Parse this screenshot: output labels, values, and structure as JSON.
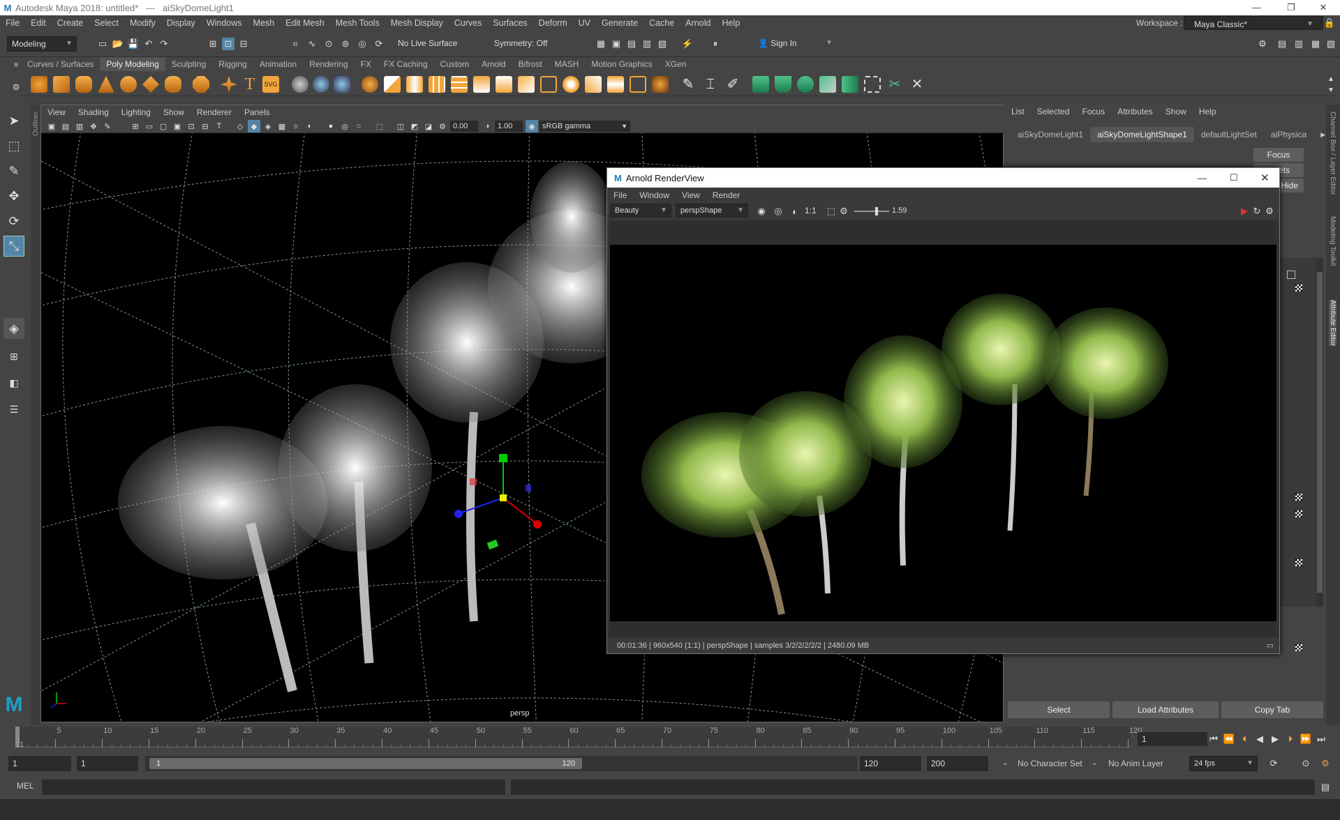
{
  "app": {
    "title": "Autodesk Maya 2018: untitled*   ---   aiSkyDomeLight1",
    "logo": "M"
  },
  "menubar": [
    "File",
    "Edit",
    "Create",
    "Select",
    "Modify",
    "Display",
    "Windows",
    "Mesh",
    "Edit Mesh",
    "Mesh Tools",
    "Mesh Display",
    "Curves",
    "Surfaces",
    "Deform",
    "UV",
    "Generate",
    "Cache",
    "Arnold",
    "Help"
  ],
  "workspace": {
    "label": "Workspace :",
    "value": "Maya Classic*"
  },
  "statusline": {
    "mode": "Modeling",
    "live_surface": "No Live Surface",
    "symmetry": "Symmetry: Off",
    "sign_in": "Sign In"
  },
  "shelf_tabs": [
    "Curves / Surfaces",
    "Poly Modeling",
    "Sculpting",
    "Rigging",
    "Animation",
    "Rendering",
    "FX",
    "FX Caching",
    "Custom",
    "Arnold",
    "Bifrost",
    "MASH",
    "Motion Graphics",
    "XGen"
  ],
  "shelf_active": "Poly Modeling",
  "outliner_label": "Outliner",
  "viewport": {
    "menu": [
      "View",
      "Shading",
      "Lighting",
      "Show",
      "Renderer",
      "Panels"
    ],
    "exposure": "0.00",
    "gamma": "1.00",
    "color_space": "sRGB gamma",
    "camera_label": "persp"
  },
  "attribute_editor": {
    "menu": [
      "List",
      "Selected",
      "Focus",
      "Attributes",
      "Show",
      "Help"
    ],
    "tabs": [
      "aiSkyDomeLight1",
      "aiSkyDomeLightShape1",
      "defaultLightSet",
      "aiPhysica"
    ],
    "active_tab": "aiSkyDomeLightShape1",
    "focus_btn": "Focus",
    "presets_btn": "ets",
    "hide_btn": "Hide",
    "bottom_buttons": [
      "Select",
      "Load Attributes",
      "Copy Tab"
    ],
    "side_tabs": [
      "Channel Box / Layer Editor",
      "Modeling Toolkit",
      "Attribute Editor"
    ]
  },
  "renderview": {
    "title": "Arnold RenderView",
    "menu": [
      "File",
      "Window",
      "View",
      "Render"
    ],
    "aov": "Beauty",
    "camera": "perspShape",
    "ratio": "1:1",
    "exposure": "1.59",
    "status": "00:01:36 | 960x540 (1:1) | perspShape  | samples 3/2/2/2/2/2 | 2480.09 MB"
  },
  "timeline": {
    "ticks": [
      "1",
      "5",
      "10",
      "15",
      "20",
      "25",
      "30",
      "35",
      "40",
      "45",
      "50",
      "55",
      "60",
      "65",
      "70",
      "75",
      "80",
      "85",
      "90",
      "95",
      "100",
      "105",
      "110",
      "115",
      "120"
    ],
    "current_frame": "1"
  },
  "range": {
    "start": "1",
    "playback_start": "1",
    "slider_start": "1",
    "slider_end": "120",
    "playback_end": "120",
    "end": "200",
    "character_set": "No Character Set",
    "anim_layer": "No Anim Layer",
    "fps": "24 fps"
  },
  "command": {
    "lang": "MEL"
  },
  "colors": {
    "accent": "#5285a6",
    "bg": "#444444",
    "field": "#2b2b2b"
  }
}
